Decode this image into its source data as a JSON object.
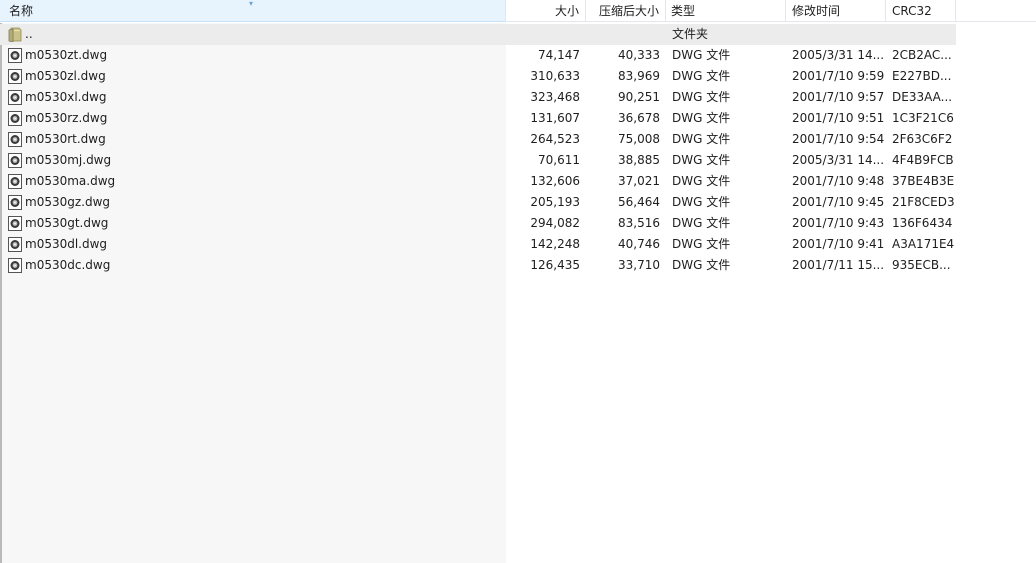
{
  "columns": {
    "name": "名称",
    "size": "大小",
    "packed": "压缩后大小",
    "type": "类型",
    "modified": "修改时间",
    "crc": "CRC32"
  },
  "sort_indicator": "▾",
  "parent_row": {
    "name": "..",
    "type": "文件夹",
    "icon": "folder-icon"
  },
  "files": [
    {
      "name": "m0530zt.dwg",
      "size": "74,147",
      "packed": "40,333",
      "type": "DWG 文件",
      "modified": "2005/3/31 14...",
      "crc": "2CB2AC...",
      "icon": "dwg-file-icon"
    },
    {
      "name": "m0530zl.dwg",
      "size": "310,633",
      "packed": "83,969",
      "type": "DWG 文件",
      "modified": "2001/7/10 9:59",
      "crc": "E227BD...",
      "icon": "dwg-file-icon"
    },
    {
      "name": "m0530xl.dwg",
      "size": "323,468",
      "packed": "90,251",
      "type": "DWG 文件",
      "modified": "2001/7/10 9:57",
      "crc": "DE33AA...",
      "icon": "dwg-file-icon"
    },
    {
      "name": "m0530rz.dwg",
      "size": "131,607",
      "packed": "36,678",
      "type": "DWG 文件",
      "modified": "2001/7/10 9:51",
      "crc": "1C3F21C6",
      "icon": "dwg-file-icon"
    },
    {
      "name": "m0530rt.dwg",
      "size": "264,523",
      "packed": "75,008",
      "type": "DWG 文件",
      "modified": "2001/7/10 9:54",
      "crc": "2F63C6F2",
      "icon": "dwg-file-icon"
    },
    {
      "name": "m0530mj.dwg",
      "size": "70,611",
      "packed": "38,885",
      "type": "DWG 文件",
      "modified": "2005/3/31 14...",
      "crc": "4F4B9FCB",
      "icon": "dwg-file-icon"
    },
    {
      "name": "m0530ma.dwg",
      "size": "132,606",
      "packed": "37,021",
      "type": "DWG 文件",
      "modified": "2001/7/10 9:48",
      "crc": "37BE4B3E",
      "icon": "dwg-file-icon"
    },
    {
      "name": "m0530gz.dwg",
      "size": "205,193",
      "packed": "56,464",
      "type": "DWG 文件",
      "modified": "2001/7/10 9:45",
      "crc": "21F8CED3",
      "icon": "dwg-file-icon"
    },
    {
      "name": "m0530gt.dwg",
      "size": "294,082",
      "packed": "83,516",
      "type": "DWG 文件",
      "modified": "2001/7/10 9:43",
      "crc": "136F6434",
      "icon": "dwg-file-icon"
    },
    {
      "name": "m0530dl.dwg",
      "size": "142,248",
      "packed": "40,746",
      "type": "DWG 文件",
      "modified": "2001/7/10 9:41",
      "crc": "A3A171E4",
      "icon": "dwg-file-icon"
    },
    {
      "name": "m0530dc.dwg",
      "size": "126,435",
      "packed": "33,710",
      "type": "DWG 文件",
      "modified": "2001/7/11 15...",
      "crc": "935ECB...",
      "icon": "dwg-file-icon"
    }
  ]
}
